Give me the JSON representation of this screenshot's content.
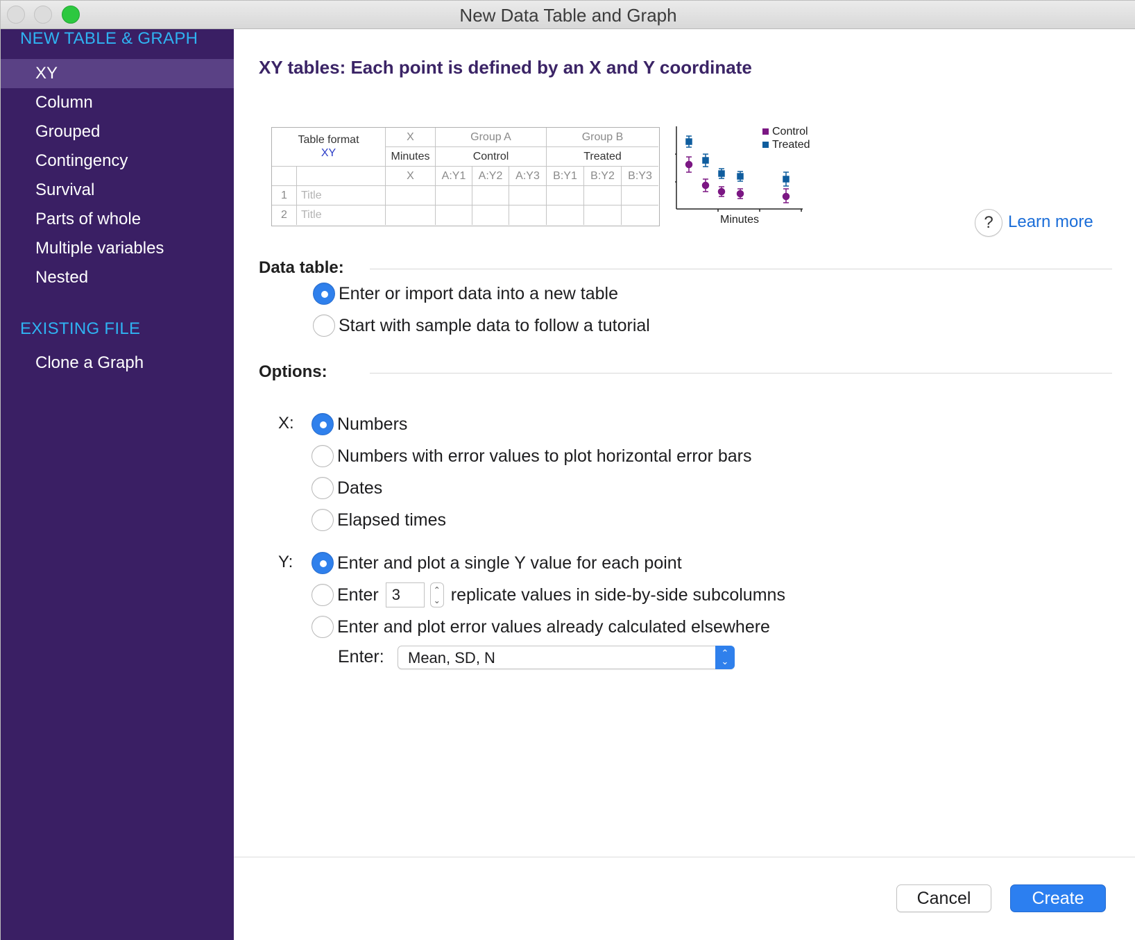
{
  "window": {
    "title": "New Data Table and Graph"
  },
  "sidebar": {
    "section1": "NEW TABLE & GRAPH",
    "items": [
      {
        "label": "XY",
        "active": true
      },
      {
        "label": "Column"
      },
      {
        "label": "Grouped"
      },
      {
        "label": "Contingency"
      },
      {
        "label": "Survival"
      },
      {
        "label": "Parts of whole"
      },
      {
        "label": "Multiple variables"
      },
      {
        "label": "Nested"
      }
    ],
    "section2": "EXISTING FILE",
    "existing_items": [
      {
        "label": "Clone a Graph"
      }
    ]
  },
  "main": {
    "heading": "XY tables: Each point is defined by an X and Y coordinate",
    "sample_table": {
      "format_label": "Table format",
      "format_value": "XY",
      "x_header": "X",
      "x_title": "Minutes",
      "x_sub": "X",
      "group_a": "Group A",
      "group_a_title": "Control",
      "group_b": "Group B",
      "group_b_title": "Treated",
      "subcols": [
        "A:Y1",
        "A:Y2",
        "A:Y3",
        "B:Y1",
        "B:Y2",
        "B:Y3"
      ],
      "rows": [
        {
          "num": "1",
          "title": "Title"
        },
        {
          "num": "2",
          "title": "Title"
        }
      ]
    },
    "mini_chart": {
      "legend": [
        "Control",
        "Treated"
      ],
      "xlabel": "Minutes",
      "colors": {
        "control": "#7b1783",
        "treated": "#0f5d9e"
      }
    },
    "help_icon": "?",
    "learn_more": "Learn more",
    "data_table": {
      "label": "Data table:",
      "options": [
        {
          "label": "Enter or import data into a new table",
          "selected": true
        },
        {
          "label": "Start with sample data to follow a tutorial",
          "selected": false
        }
      ]
    },
    "options": {
      "label": "Options:",
      "x_label": "X:",
      "x_options": [
        {
          "label": "Numbers",
          "selected": true
        },
        {
          "label": "Numbers with error values to plot horizontal error bars",
          "selected": false
        },
        {
          "label": "Dates",
          "selected": false
        },
        {
          "label": "Elapsed times",
          "selected": false
        }
      ],
      "y_label": "Y:",
      "y_single": "Enter and plot a single Y value for each point",
      "y_replicate_prefix": "Enter",
      "y_replicate_value": "3",
      "y_replicate_suffix": "replicate values in side-by-side subcolumns",
      "y_error": "Enter and plot error values already calculated elsewhere",
      "enter_label": "Enter:",
      "enter_select": "Mean, SD, N"
    }
  },
  "footer": {
    "cancel": "Cancel",
    "create": "Create"
  },
  "colors": {
    "sidebar_bg": "#3a1f64",
    "accent": "#2f80ec",
    "sidebar_heading": "#2fb3f2"
  }
}
